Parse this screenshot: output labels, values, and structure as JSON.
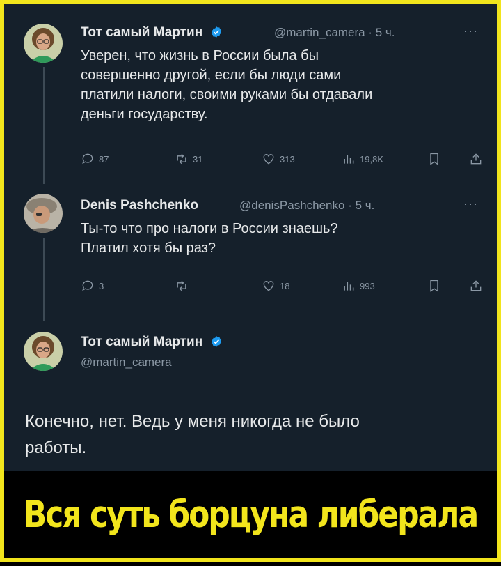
{
  "tweet1": {
    "author_name": "Тот самый Мартин",
    "handle_time": "@martin_camera · 5 ч.",
    "more": "···",
    "text_lines": [
      "Уверен, что жизнь в России была бы",
      "совершенно другой, если бы люди сами",
      "платили налоги, своими руками бы отдавали",
      "деньги государству."
    ],
    "stats": {
      "replies": "87",
      "retweets": "31",
      "likes": "313",
      "views": "19,8K"
    }
  },
  "tweet2": {
    "author_name": "Denis Pashchenko",
    "handle_time": "@denisPashchenko · 5 ч.",
    "more": "···",
    "text_lines": [
      "Ты-то что про налоги в России знаешь?",
      "Платил хотя бы раз?"
    ],
    "stats": {
      "replies": "3",
      "retweets": "",
      "likes": "18",
      "views": "993"
    }
  },
  "tweet3": {
    "author_name": "Тот самый Мартин",
    "handle": "@martin_camera",
    "text_lines": [
      "Конечно, нет. Ведь у меня никогда не было",
      "работы."
    ]
  },
  "caption": "Вся суть борцуна либерала",
  "icons": {
    "reply": "reply-icon",
    "retweet": "retweet-icon",
    "like": "like-icon",
    "views": "views-icon",
    "bookmark": "bookmark-icon",
    "share": "share-icon",
    "verified": "verified-badge-icon"
  },
  "colors": {
    "background": "#15202b",
    "frame": "#f2e51c",
    "verified": "#1d9bf0",
    "muted": "#8b98a5"
  }
}
